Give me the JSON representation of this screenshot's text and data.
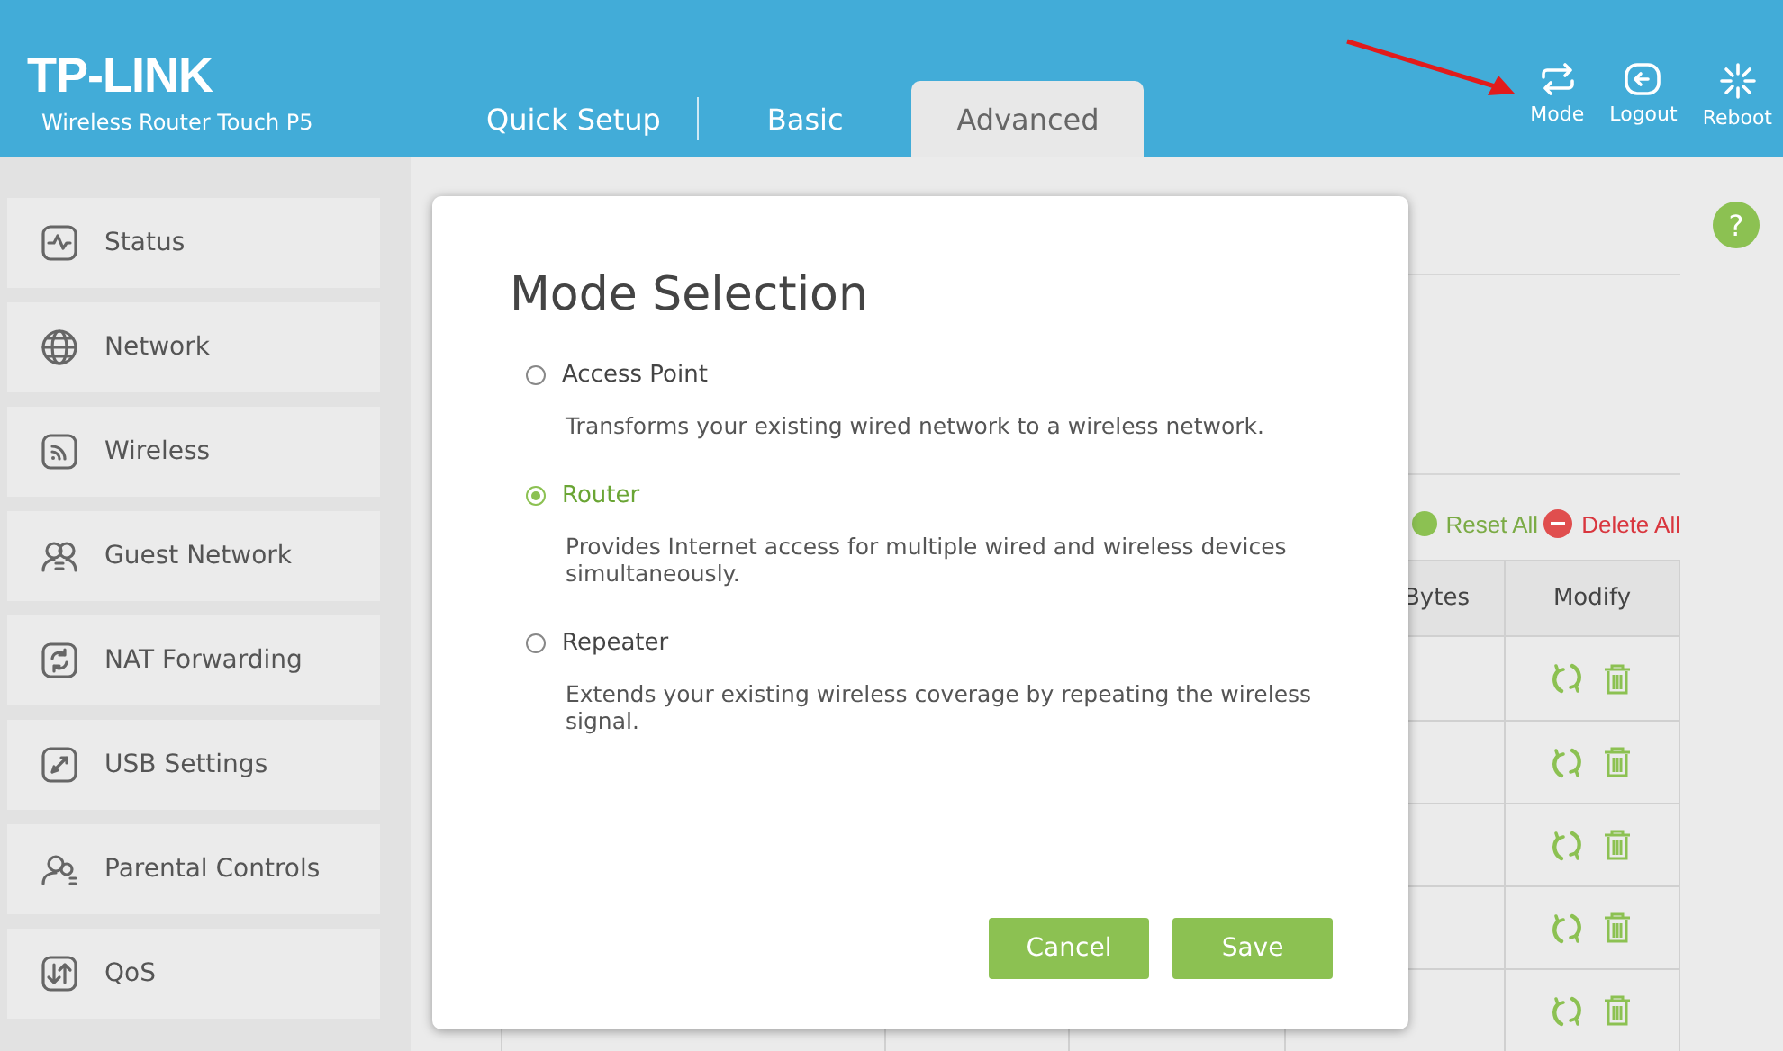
{
  "header": {
    "logo": "TP-LINK",
    "model": "Wireless Router Touch P5"
  },
  "tabs": [
    {
      "label": "Quick Setup",
      "selected": false
    },
    {
      "label": "Basic",
      "selected": false
    },
    {
      "label": "Advanced",
      "selected": true
    }
  ],
  "top_actions": [
    {
      "label": "Mode",
      "kind": "mode"
    },
    {
      "label": "Logout",
      "kind": "logout"
    },
    {
      "label": "Reboot",
      "kind": "reboot"
    }
  ],
  "sidebar": {
    "items": [
      {
        "label": "Status",
        "kind": "status"
      },
      {
        "label": "Network",
        "kind": "network"
      },
      {
        "label": "Wireless",
        "kind": "wireless"
      },
      {
        "label": "Guest Network",
        "kind": "guest"
      },
      {
        "label": "NAT Forwarding",
        "kind": "nat"
      },
      {
        "label": "USB Settings",
        "kind": "usb"
      },
      {
        "label": "Parental Controls",
        "kind": "parental"
      },
      {
        "label": "QoS",
        "kind": "qos"
      }
    ]
  },
  "help": {
    "label": "?"
  },
  "panel": {
    "actions": [
      {
        "label": "Reset All",
        "kind": "reset"
      },
      {
        "label": "Delete All",
        "kind": "delete"
      }
    ],
    "table": {
      "column_4": "Bytes",
      "column_5": "Modify",
      "rows": [
        {
          "kind": "entry"
        },
        {
          "kind": "entry"
        },
        {
          "kind": "entry"
        },
        {
          "kind": "entry"
        },
        {
          "kind": "entry"
        }
      ]
    }
  },
  "dialog": {
    "title": "Mode Selection",
    "options": [
      {
        "label": "Access Point",
        "description": "Transforms your existing wired network to a wireless network.",
        "selected": false
      },
      {
        "label": "Router",
        "description": "Provides Internet access for multiple wired and wireless devices simultaneously.",
        "selected": true
      },
      {
        "label": "Repeater",
        "description": "Extends your existing wireless coverage by repeating the wireless signal.",
        "selected": false
      }
    ],
    "buttons": [
      {
        "label": "Cancel"
      },
      {
        "label": "Save"
      }
    ]
  }
}
